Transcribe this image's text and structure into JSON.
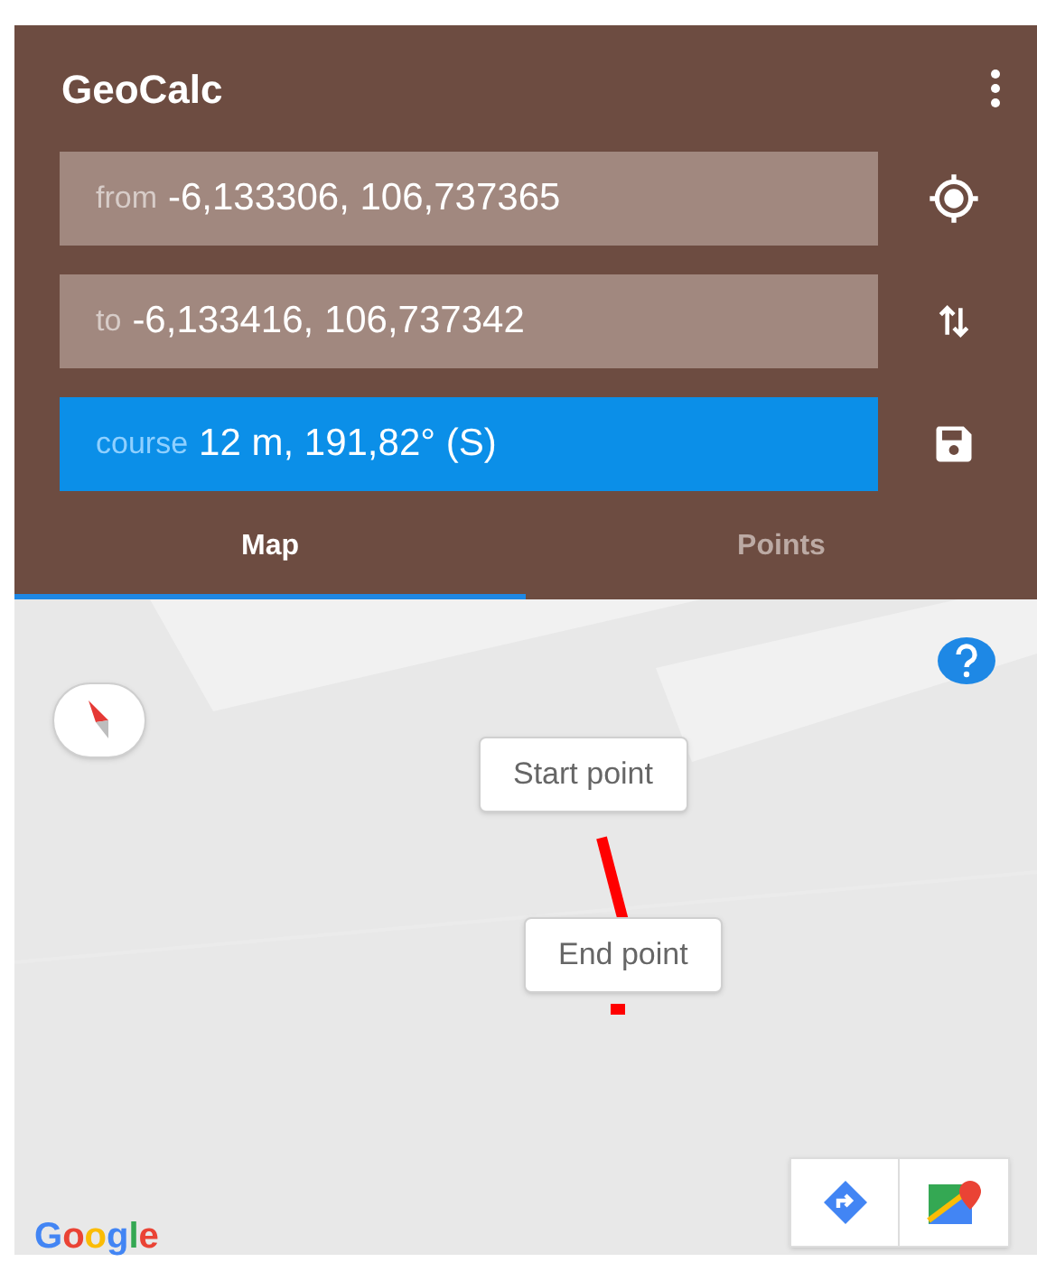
{
  "app_bar": {
    "title": "GeoCalc"
  },
  "fields": [
    {
      "label": "from",
      "value": "-6,133306, 106,737365",
      "highlighted": false
    },
    {
      "label": "to",
      "value": "-6,133416, 106,737342",
      "highlighted": false
    },
    {
      "label": "course",
      "value": "12 m, 191,82° (S)",
      "highlighted": true
    }
  ],
  "tabs": [
    {
      "label": "Map",
      "selected": true
    },
    {
      "label": "Points",
      "selected": false
    }
  ],
  "map": {
    "markers": [
      {
        "label": "Start point"
      },
      {
        "label": "End point"
      }
    ],
    "attribution": "Google"
  }
}
